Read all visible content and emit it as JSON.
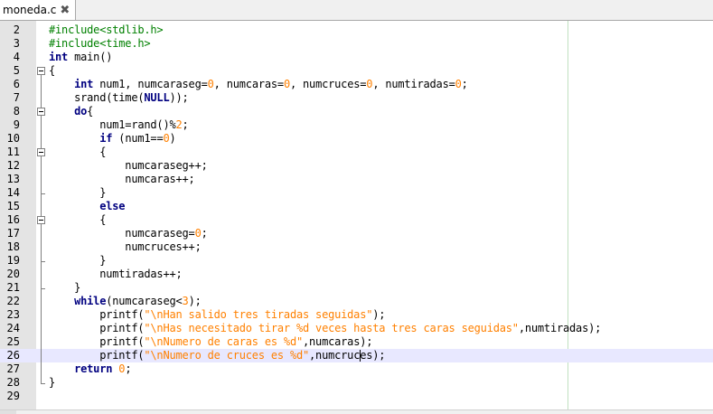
{
  "tab": {
    "filename": "moneda.c"
  },
  "editor": {
    "current_line": 26,
    "lines": [
      {
        "n": "2",
        "t": "#include<stdlib.h>"
      },
      {
        "n": "3",
        "t": "#include<time.h>"
      },
      {
        "n": "4",
        "t": "int main()"
      },
      {
        "n": "5",
        "t": "{"
      },
      {
        "n": "6",
        "t": "    int num1, numcaraseg=0, numcaras=0, numcruces=0, numtiradas=0;"
      },
      {
        "n": "7",
        "t": "    srand(time(NULL));"
      },
      {
        "n": "8",
        "t": "    do{"
      },
      {
        "n": "9",
        "t": "        num1=rand()%2;"
      },
      {
        "n": "10",
        "t": "        if (num1==0)"
      },
      {
        "n": "11",
        "t": "        {"
      },
      {
        "n": "12",
        "t": "            numcaraseg++;"
      },
      {
        "n": "13",
        "t": "            numcaras++;"
      },
      {
        "n": "14",
        "t": "        }"
      },
      {
        "n": "15",
        "t": "        else"
      },
      {
        "n": "16",
        "t": "        {"
      },
      {
        "n": "17",
        "t": "            numcaraseg=0;"
      },
      {
        "n": "18",
        "t": "            numcruces++;"
      },
      {
        "n": "19",
        "t": "        }"
      },
      {
        "n": "20",
        "t": "        numtiradas++;"
      },
      {
        "n": "21",
        "t": "    }"
      },
      {
        "n": "22",
        "t": "    while(numcaraseg<3);"
      },
      {
        "n": "23",
        "t": "        printf(\"\\nHan salido tres tiradas seguidas\");"
      },
      {
        "n": "24",
        "t": "        printf(\"\\nHas necesitado tirar %d veces hasta tres caras seguidas\",numtiradas);"
      },
      {
        "n": "25",
        "t": "        printf(\"\\nNumero de caras es %d\",numcaras);"
      },
      {
        "n": "26",
        "t": "        printf(\"\\nNumero de cruces es %d\",numcruces);"
      },
      {
        "n": "27",
        "t": "    return 0;"
      },
      {
        "n": "28",
        "t": "}"
      },
      {
        "n": "29",
        "t": ""
      }
    ]
  }
}
